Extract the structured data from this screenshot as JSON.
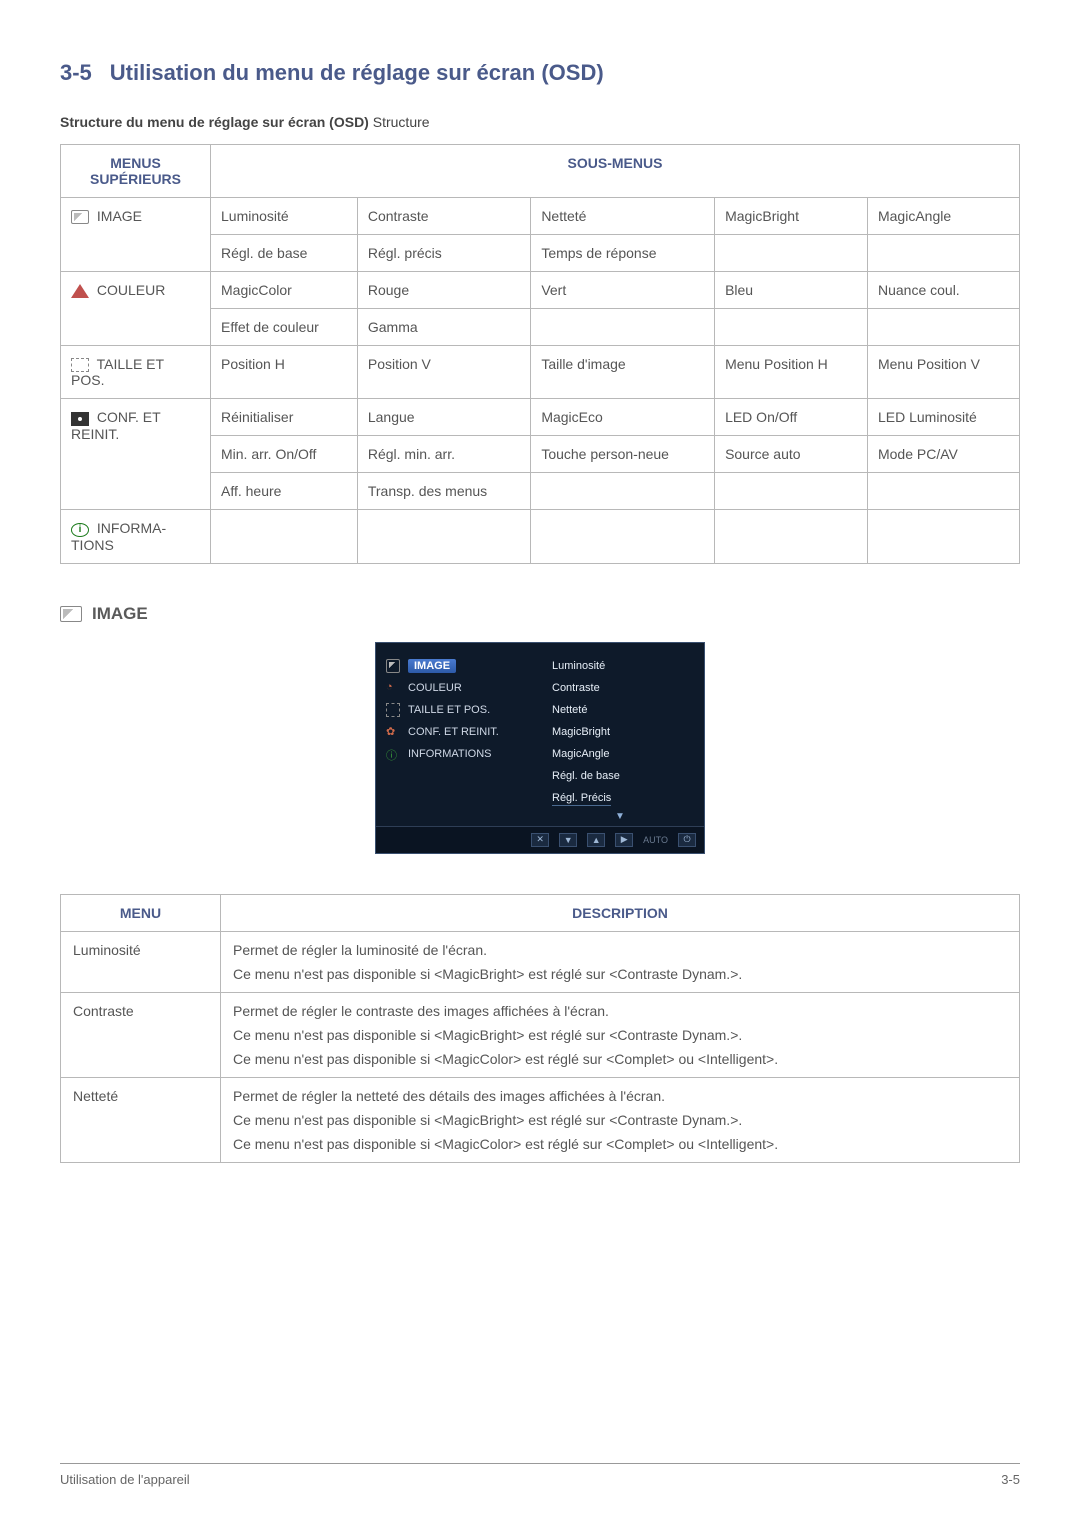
{
  "section": {
    "number": "3-5",
    "title": "Utilisation du menu de réglage sur écran (OSD)"
  },
  "structure_intro_bold": "Structure du menu de réglage sur écran (OSD)",
  "structure_intro_rest": " Structure",
  "table_headers": {
    "left": "MENUS SUPÉRIEURS",
    "right": "SOUS-MENUS"
  },
  "menus": {
    "image": "IMAGE",
    "couleur": "COULEUR",
    "taille": "TAILLE ET POS.",
    "conf": "CONF. ET REINIT.",
    "info": "INFORMA-TIONS"
  },
  "sub": {
    "image_r1": [
      "Luminosité",
      "Contraste",
      "Netteté",
      "MagicBright",
      "MagicAngle"
    ],
    "image_r2": [
      "Régl. de base",
      "Régl. précis",
      "Temps de réponse",
      "",
      ""
    ],
    "couleur_r1": [
      "MagicColor",
      "Rouge",
      "Vert",
      "Bleu",
      "Nuance coul."
    ],
    "couleur_r2": [
      "Effet de couleur",
      "Gamma",
      "",
      "",
      ""
    ],
    "taille_r1": [
      "Position H",
      "Position V",
      "Taille d'image",
      "Menu Position H",
      "Menu Position V"
    ],
    "conf_r1": [
      "Réinitialiser",
      "Langue",
      "MagicEco",
      "LED On/Off",
      "LED Luminosité"
    ],
    "conf_r2": [
      "Min. arr. On/Off",
      "Régl. min. arr.",
      "Touche person-neue",
      "Source auto",
      "Mode PC/AV"
    ],
    "conf_r3": [
      "Aff. heure",
      "Transp. des menus",
      "",
      "",
      ""
    ]
  },
  "image_heading": "IMAGE",
  "osd": {
    "left": [
      "IMAGE",
      "COULEUR",
      "TAILLE ET POS.",
      "CONF. ET REINIT.",
      "INFORMATIONS"
    ],
    "right": [
      "Luminosité",
      "Contraste",
      "Netteté",
      "MagicBright",
      "MagicAngle",
      "Régl. de base",
      "Régl. Précis"
    ],
    "bottom_auto": "AUTO"
  },
  "desc_headers": {
    "menu": "MENU",
    "desc": "DESCRIPTION"
  },
  "desc_rows": {
    "lum": {
      "name": "Luminosité",
      "p1": "Permet de régler la luminosité de l'écran.",
      "p2": "Ce menu n'est pas disponible si <MagicBright> est réglé sur <Contraste Dynam.>."
    },
    "con": {
      "name": "Contraste",
      "p1": "Permet de régler le contraste des images affichées à l'écran.",
      "p2": "Ce menu n'est pas disponible si <MagicBright> est réglé sur <Contraste Dynam.>.",
      "p3": "Ce menu n'est pas disponible si <MagicColor> est réglé sur <Complet> ou <Intelligent>."
    },
    "net": {
      "name": "Netteté",
      "p1": "Permet de régler la netteté des détails des images affichées à l'écran.",
      "p2": "Ce menu n'est pas disponible si <MagicBright> est réglé sur <Contraste Dynam.>.",
      "p3": "Ce menu n'est pas disponible si <MagicColor> est réglé sur <Complet> ou <Intelligent>."
    }
  },
  "footer": {
    "left": "Utilisation de l'appareil",
    "right": "3-5"
  }
}
